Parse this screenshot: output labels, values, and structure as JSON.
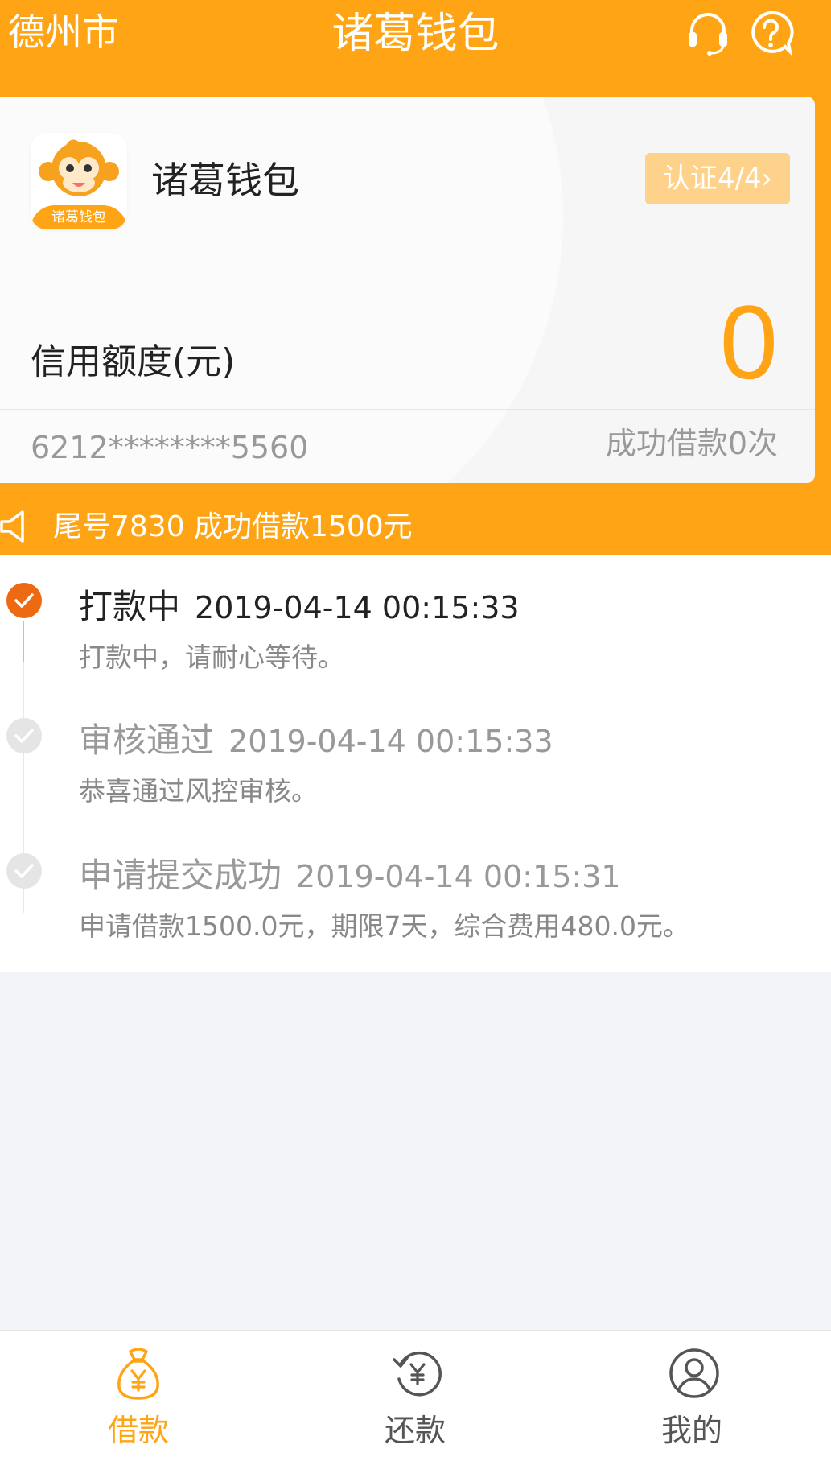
{
  "header": {
    "city": "德州市",
    "title": "诸葛钱包",
    "icons": [
      "headset-icon",
      "help-icon"
    ],
    "bg_color": "#ffa515"
  },
  "card": {
    "logo_text": "诸葛钱包",
    "brand": "诸葛钱包",
    "badge": "认证4/4",
    "limit_label": "信用额度(元)",
    "limit_value": "0",
    "card_number": "6212********5560",
    "loan_count": "成功借款0次"
  },
  "notice": {
    "text": "尾号7830 成功借款1500元"
  },
  "timeline": [
    {
      "name": "打款中",
      "time": "2019-04-14 00:15:33",
      "desc": "打款中，请耐心等待。",
      "status": "active"
    },
    {
      "name": "审核通过",
      "time": "2019-04-14 00:15:33",
      "desc": "恭喜通过风控审核。",
      "status": "done"
    },
    {
      "name": "申请提交成功",
      "time": "2019-04-14 00:15:31",
      "desc": "申请借款1500.0元，期限7天，综合费用480.0元。",
      "status": "done"
    }
  ],
  "tabs": [
    {
      "label": "借款",
      "icon": "money-bag-icon",
      "active": true
    },
    {
      "label": "还款",
      "icon": "repay-icon",
      "active": false
    },
    {
      "label": "我的",
      "icon": "profile-icon",
      "active": false
    }
  ],
  "colors": {
    "accent": "#ffa515",
    "active_step": "#ee6a12",
    "inactive_tab": "#555555"
  }
}
